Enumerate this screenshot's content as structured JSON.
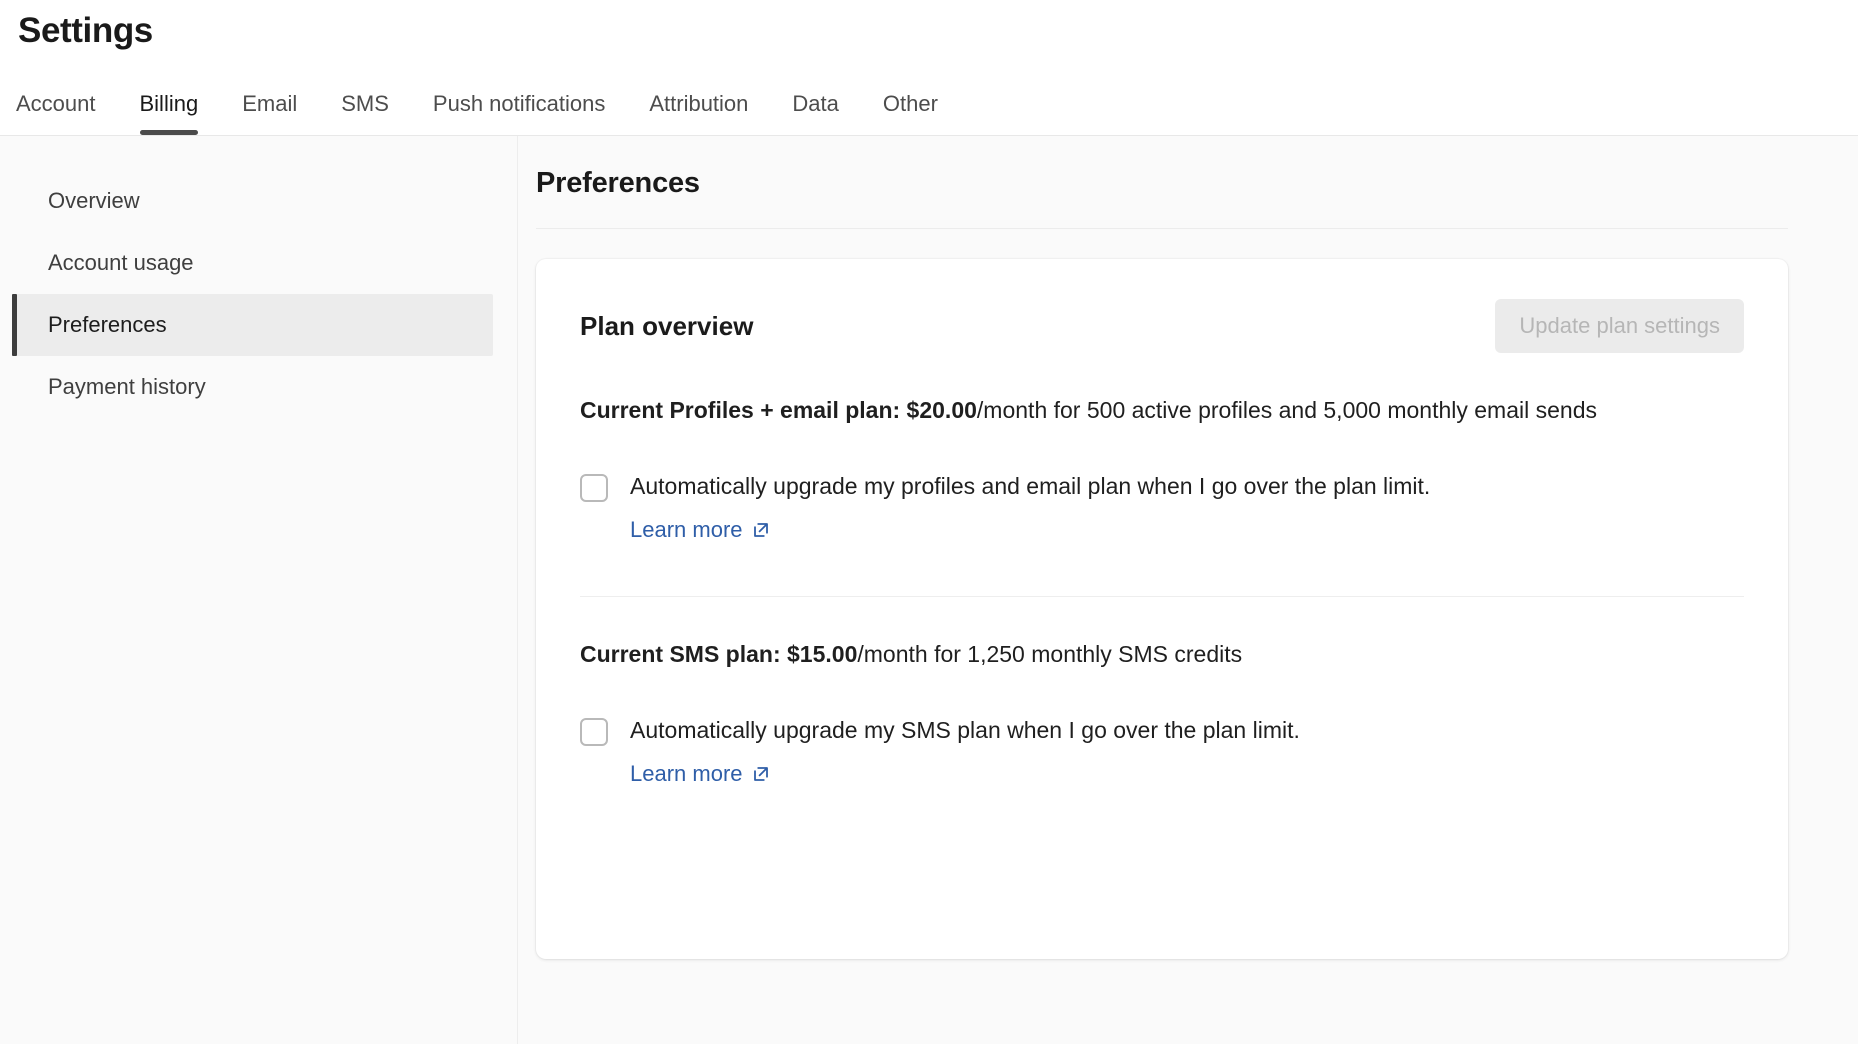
{
  "header": {
    "title": "Settings"
  },
  "tabs": [
    {
      "label": "Account",
      "active": false
    },
    {
      "label": "Billing",
      "active": true
    },
    {
      "label": "Email",
      "active": false
    },
    {
      "label": "SMS",
      "active": false
    },
    {
      "label": "Push notifications",
      "active": false
    },
    {
      "label": "Attribution",
      "active": false
    },
    {
      "label": "Data",
      "active": false
    },
    {
      "label": "Other",
      "active": false
    }
  ],
  "sidebar": {
    "items": [
      {
        "label": "Overview",
        "active": false
      },
      {
        "label": "Account usage",
        "active": false
      },
      {
        "label": "Preferences",
        "active": true
      },
      {
        "label": "Payment history",
        "active": false
      }
    ]
  },
  "main": {
    "title": "Preferences",
    "card": {
      "title": "Plan overview",
      "update_button": {
        "label": "Update plan settings",
        "disabled": true
      },
      "email_plan": {
        "bold_prefix": "Current Profiles + email plan: $20.00",
        "rest": "/month for 500 active profiles and 5,000 monthly email sends",
        "checkbox": {
          "checked": false,
          "label": "Automatically upgrade my profiles and email plan when I go over the plan limit.",
          "link_label": "Learn more",
          "link_icon": "external-link-icon"
        }
      },
      "sms_plan": {
        "bold_prefix": "Current SMS plan: $15.00",
        "rest": "/month for 1,250 monthly SMS credits",
        "checkbox": {
          "checked": false,
          "label": "Automatically upgrade my SMS plan when I go over the plan limit.",
          "link_label": "Learn more",
          "link_icon": "external-link-icon"
        }
      }
    }
  },
  "colors": {
    "accent_link": "#2f5ea8",
    "active_tab_underline": "#4b4b4b",
    "active_sidebar_bar": "#3d3d3d",
    "page_bg": "#fafafa",
    "card_bg": "#ffffff",
    "disabled_button_bg": "#ebebeb"
  }
}
